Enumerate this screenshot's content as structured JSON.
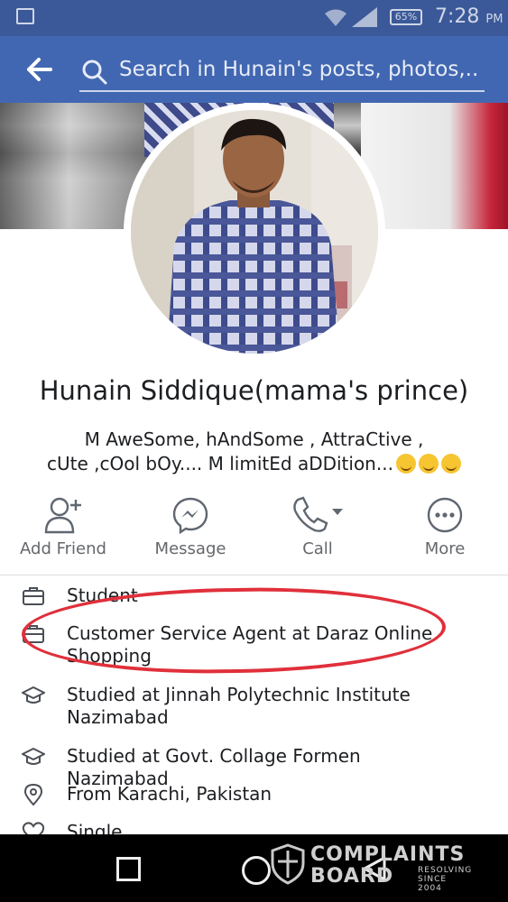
{
  "status_bar": {
    "battery": "65%",
    "time": "7:28",
    "ampm": "PM"
  },
  "app_bar": {
    "search_placeholder": "Search in Hunain's posts, photos,..."
  },
  "profile": {
    "name": "Hunain Siddique(mama's prince)",
    "bio_line1": "M AweSome, hAndSome , AttraCtive ,",
    "bio_line2": "cUte ,cOol bOy.... M limitEd aDDition..."
  },
  "actions": [
    {
      "label": "Add Friend",
      "icon": "add-friend-icon"
    },
    {
      "label": "Message",
      "icon": "messenger-icon"
    },
    {
      "label": "Call",
      "icon": "phone-icon"
    },
    {
      "label": "More",
      "icon": "more-icon"
    }
  ],
  "info": [
    {
      "icon": "briefcase-icon",
      "text": "Student"
    },
    {
      "icon": "briefcase-icon",
      "text": "Customer Service Agent at Daraz Online Shopping"
    },
    {
      "icon": "graduation-cap-icon",
      "text": "Studied at  Jinnah Polytechnic Institute Nazimabad"
    },
    {
      "icon": "graduation-cap-icon",
      "text": "Studied at Govt. Collage Formen Nazimabad"
    },
    {
      "icon": "location-pin-icon",
      "text": "From Karachi, Pakistan"
    },
    {
      "icon": "heart-icon",
      "text": "Single"
    }
  ],
  "watermark": {
    "line1": "COMPLAINTS",
    "line2": "BOARD",
    "line3a": "RESOLVING",
    "line3b": "SINCE 2004"
  },
  "colors": {
    "status_bar": "#3b5998",
    "app_bar": "#4267b2",
    "highlight": "#e0303b"
  }
}
